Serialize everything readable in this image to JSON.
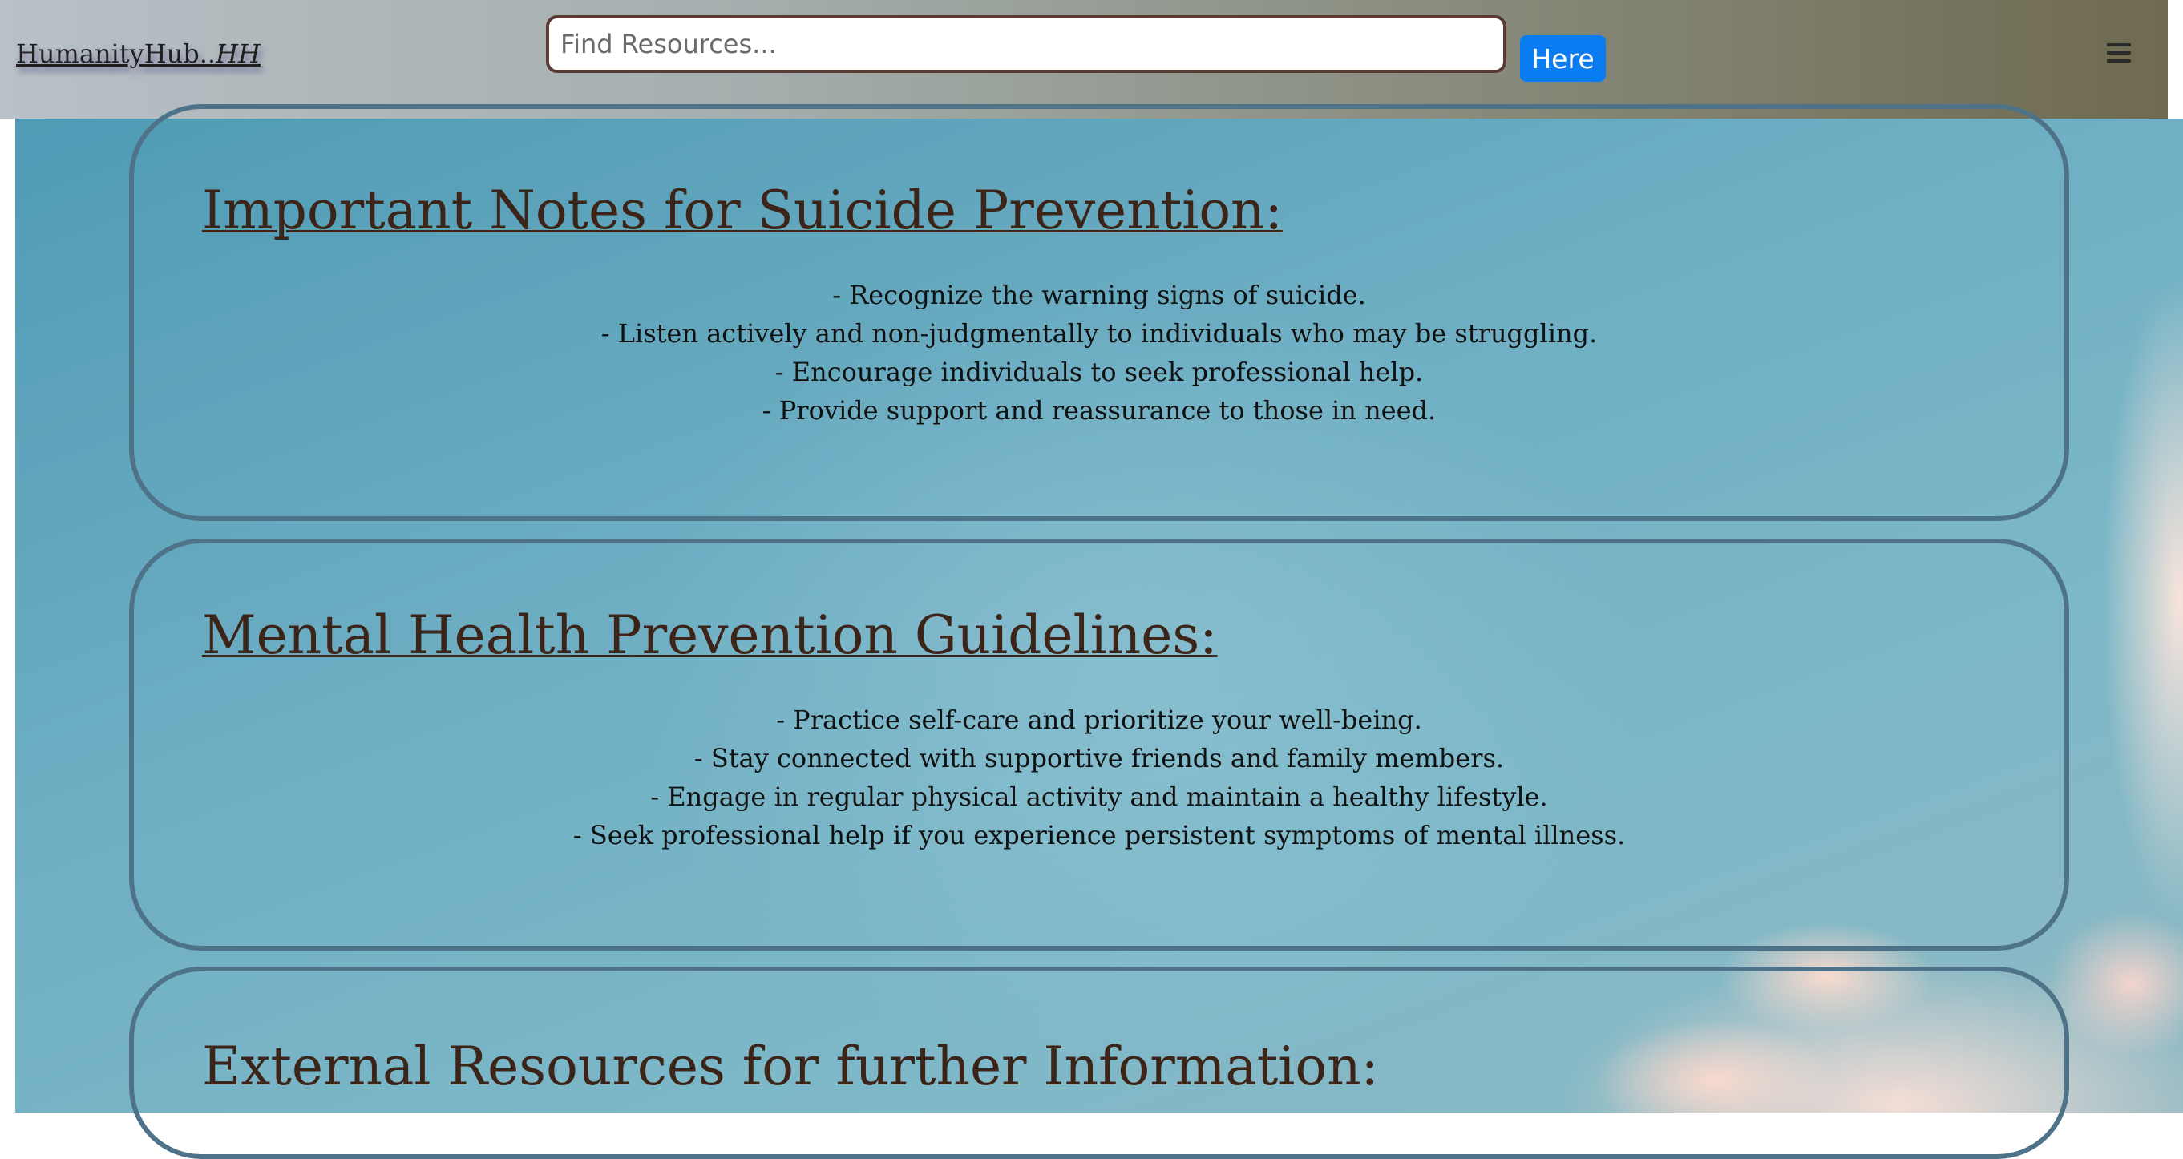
{
  "header": {
    "brand_text": "HumanityHub..",
    "brand_suffix": "HH",
    "search_placeholder": "Find Resources...",
    "search_button_label": "Here",
    "menu_icon": "hamburger-menu-icon"
  },
  "sections": [
    {
      "title": "Important Notes for Suicide Prevention:",
      "lines": [
        "- Recognize the warning signs of suicide.",
        "- Listen actively and non-judgmentally to individuals who may be struggling.",
        "- Encourage individuals to seek professional help.",
        "- Provide support and reassurance to those in need."
      ]
    },
    {
      "title": "Mental Health Prevention Guidelines:",
      "lines": [
        "- Practice self-care and prioritize your well-being.",
        "- Stay connected with supportive friends and family members.",
        "- Engage in regular physical activity and maintain a healthy lifestyle.",
        "- Seek professional help if you experience persistent symptoms of mental illness."
      ]
    },
    {
      "title": "External Resources for further Information:"
    }
  ],
  "colors": {
    "accent_button": "#0a7cf2",
    "card_border": "#4e7389",
    "heading_text": "#3d2418",
    "search_border": "#5a3a33"
  }
}
